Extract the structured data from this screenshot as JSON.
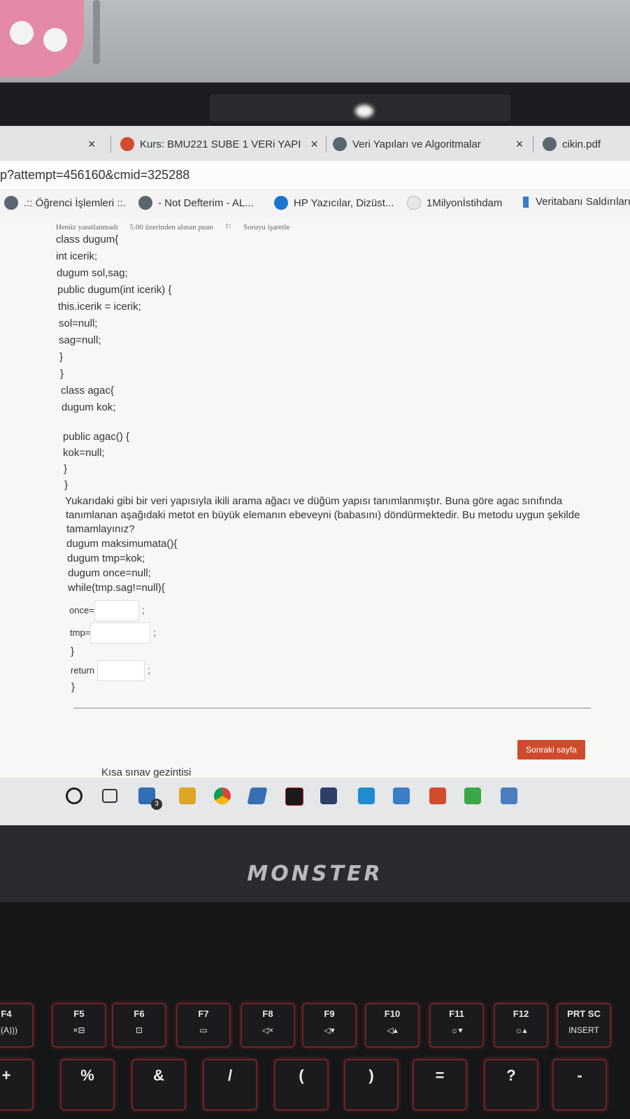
{
  "browser": {
    "tabs": [
      {
        "label": "Kurs: BMU221 SUBE 1 VERi YAPI",
        "close": "×"
      },
      {
        "label": "Veri Yapıları ve Algoritmalar",
        "close": "×"
      },
      {
        "label": "cikin.pdf"
      }
    ],
    "first_tab_close": "×",
    "url": "p?attempt=456160&cmid=325288",
    "bookmarks": [
      ".:: Öğrenci İşlemleri ::.",
      "- Not Defterim - AL...",
      "HP Yazıcılar, Dizüst...",
      "1Milyonİstihdam",
      "Veritabanı Saldırıları"
    ]
  },
  "question": {
    "status": "Henüz yanıtlanmadı",
    "points": "5.00 üzerinden alınan puan",
    "flag": "Soruyu işaretle",
    "code_lines": [
      "class dugum{",
      "int icerik;",
      "dugum sol,sag;",
      "public dugum(int icerik) {",
      "this.icerik = icerik;",
      "sol=null;",
      "sag=null;",
      "}",
      "}",
      "class agac{",
      "dugum kok;",
      "public agac() {",
      "kok=null;",
      "}",
      "}"
    ],
    "prompt": [
      "Yukarıdaki gibi bir veri yapısıyla ikili arama ağacı ve düğüm yapısı tanımlanmıştır. Buna göre agac sınıfında",
      "tanımlanan aşağıdaki metot en büyük elemanın ebeveyni (babasını) döndürmektedir. Bu metodu uygun şekilde",
      "tamamlayınız?"
    ],
    "method_lines": [
      "dugum maksimumata(){",
      "dugum tmp=kok;",
      "dugum once=null;",
      "while(tmp.sag!=null){"
    ],
    "once_label": "once=",
    "tmp_label": "tmp=",
    "close_brace": "}",
    "return_label": "return",
    "end_brace": "}",
    "semicolon": ";",
    "answers": {
      "once": "",
      "tmp": "",
      "return": ""
    }
  },
  "next_button": "Sonraki sayfa",
  "quiz_nav": "Kısa sınav gezintisi",
  "taskbar": {
    "mail_badge": "3"
  },
  "laptop": {
    "brand": "MONSTER",
    "fkeys": [
      {
        "top": "F4",
        "bottom": "(((A)))"
      },
      {
        "top": "F5",
        "bottom": "×⊟"
      },
      {
        "top": "F6",
        "bottom": "⊡"
      },
      {
        "top": "F7",
        "bottom": "▭"
      },
      {
        "top": "F8",
        "bottom": "◁×"
      },
      {
        "top": "F9",
        "bottom": "◁▾"
      },
      {
        "top": "F10",
        "bottom": "◁▴"
      },
      {
        "top": "F11",
        "bottom": "☼▾"
      },
      {
        "top": "F12",
        "bottom": "☼▴"
      },
      {
        "top": "PRT SC",
        "bottom": "INSERT"
      }
    ],
    "numkeys": [
      "+",
      "%",
      "&",
      "/",
      "(",
      ")",
      "=",
      "?",
      "-"
    ]
  }
}
